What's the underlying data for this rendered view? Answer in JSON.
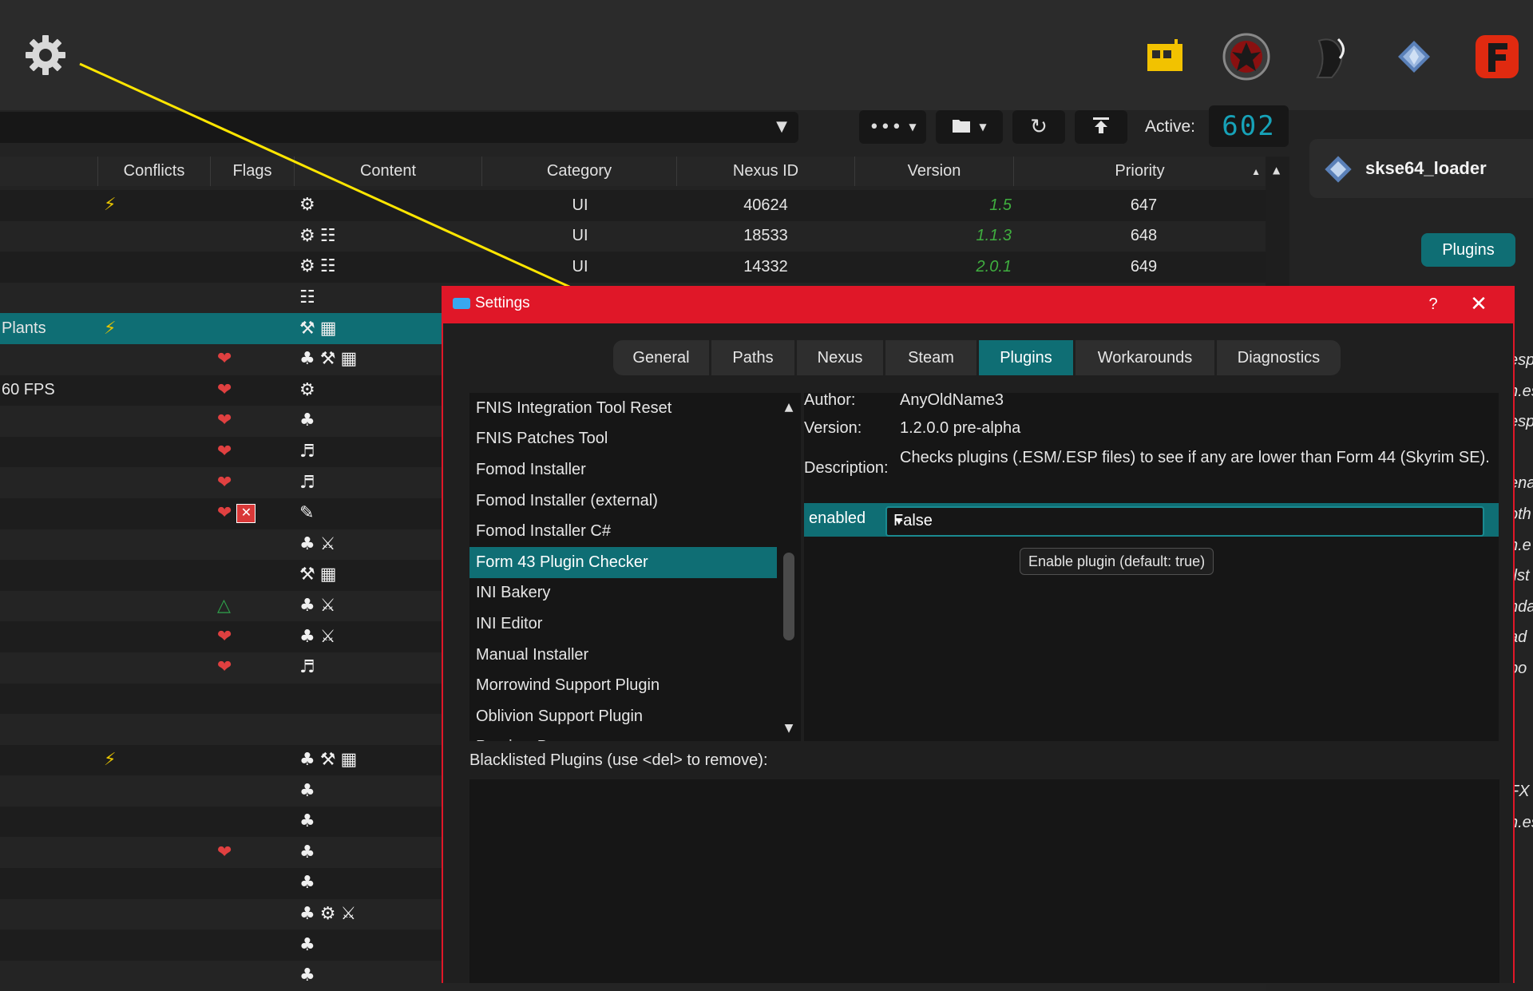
{
  "toolbar": {
    "icons": [
      "gear-icon",
      "loot-icon",
      "skyrim-dragon-icon",
      "wrye-icon",
      "skse-diamond-icon",
      "fnis-icon"
    ],
    "buttons": [
      "more-icon",
      "folder-icon",
      "refresh-icon",
      "upload-icon"
    ],
    "active_label": "Active:",
    "active_count": "602"
  },
  "executable": {
    "name": "skse64_loader"
  },
  "right_panel": {
    "tab_label": "Plugins",
    "strip_fragments": [
      "esp",
      "n.es",
      "esp",
      "",
      "ena",
      "oth",
      "n.e",
      "Ilst",
      "nda",
      "ad",
      "bo",
      "",
      "",
      "",
      "FX",
      "n.es"
    ]
  },
  "mod_table": {
    "headers": [
      "Conflicts",
      "Flags",
      "Content",
      "Category",
      "Nexus ID",
      "Version",
      "Priority"
    ],
    "rows": [
      {
        "name": "",
        "conflict": "bolt",
        "flags": [],
        "content": [
          "ui-icon"
        ],
        "category": "UI",
        "nexus_id": "40624",
        "version": "1.5",
        "priority": "647"
      },
      {
        "name": "",
        "conflict": "",
        "flags": [],
        "content": [
          "ui-icon",
          "interface-icon"
        ],
        "category": "UI",
        "nexus_id": "18533",
        "version": "1.1.3",
        "priority": "648"
      },
      {
        "name": "",
        "conflict": "",
        "flags": [],
        "content": [
          "ui-icon",
          "interface-icon"
        ],
        "category": "UI",
        "nexus_id": "14332",
        "version": "2.0.1",
        "priority": "649"
      },
      {
        "name": "",
        "conflict": "",
        "flags": [],
        "content": [
          "interface-icon"
        ],
        "category": "",
        "nexus_id": "",
        "version": "",
        "priority": ""
      },
      {
        "name": "Plants",
        "conflict": "bolt",
        "flags": [],
        "content": [
          "mesh-icon",
          "texture-icon"
        ],
        "category": "",
        "nexus_id": "",
        "version": "",
        "priority": "",
        "selected": true
      },
      {
        "name": "",
        "conflict": "",
        "flags": [
          "heart"
        ],
        "content": [
          "plugin-icon",
          "mesh-icon",
          "texture-icon"
        ],
        "category": "",
        "nexus_id": "",
        "version": "",
        "priority": ""
      },
      {
        "name": "60 FPS",
        "conflict": "",
        "flags": [
          "heart"
        ],
        "content": [
          "ui-icon"
        ],
        "category": "",
        "nexus_id": "",
        "version": "",
        "priority": ""
      },
      {
        "name": "",
        "conflict": "",
        "flags": [
          "heart"
        ],
        "content": [
          "plugin-icon"
        ],
        "category": "",
        "nexus_id": "",
        "version": "",
        "priority": ""
      },
      {
        "name": "",
        "conflict": "",
        "flags": [
          "heart"
        ],
        "content": [
          "lyre-icon"
        ],
        "category": "",
        "nexus_id": "",
        "version": "",
        "priority": ""
      },
      {
        "name": "",
        "conflict": "",
        "flags": [
          "heart"
        ],
        "content": [
          "lyre-icon"
        ],
        "category": "",
        "nexus_id": "",
        "version": "",
        "priority": ""
      },
      {
        "name": "",
        "conflict": "",
        "flags": [
          "heart",
          "x"
        ],
        "content": [
          "script-icon"
        ],
        "category": "",
        "nexus_id": "",
        "version": "",
        "priority": ""
      },
      {
        "name": "",
        "conflict": "",
        "flags": [],
        "content": [
          "plugin-icon",
          "tools-icon"
        ],
        "category": "",
        "nexus_id": "",
        "version": "",
        "priority": ""
      },
      {
        "name": "",
        "conflict": "",
        "flags": [],
        "content": [
          "mesh-icon",
          "texture-icon"
        ],
        "category": "",
        "nexus_id": "",
        "version": "",
        "priority": ""
      },
      {
        "name": "",
        "conflict": "",
        "flags": [
          "tree"
        ],
        "content": [
          "plugin-icon",
          "tools-icon"
        ],
        "category": "",
        "nexus_id": "",
        "version": "",
        "priority": ""
      },
      {
        "name": "",
        "conflict": "",
        "flags": [
          "heart"
        ],
        "content": [
          "plugin-icon",
          "tools-icon"
        ],
        "category": "",
        "nexus_id": "",
        "version": "",
        "priority": ""
      },
      {
        "name": "",
        "conflict": "",
        "flags": [
          "heart"
        ],
        "content": [
          "lyre-icon"
        ],
        "category": "",
        "nexus_id": "",
        "version": "",
        "priority": ""
      },
      {
        "name": "",
        "conflict": "",
        "flags": [],
        "content": [],
        "category": "",
        "nexus_id": "",
        "version": "",
        "priority": ""
      },
      {
        "name": "",
        "conflict": "",
        "flags": [],
        "content": [],
        "category": "",
        "nexus_id": "",
        "version": "",
        "priority": ""
      },
      {
        "name": "",
        "conflict": "bolt",
        "flags": [],
        "content": [
          "plugin-icon",
          "mesh-icon",
          "texture-icon"
        ],
        "category": "",
        "nexus_id": "",
        "version": "",
        "priority": ""
      },
      {
        "name": "",
        "conflict": "",
        "flags": [],
        "content": [
          "plugin-icon"
        ],
        "category": "",
        "nexus_id": "",
        "version": "",
        "priority": ""
      },
      {
        "name": "",
        "conflict": "",
        "flags": [],
        "content": [
          "plugin-icon"
        ],
        "category": "",
        "nexus_id": "",
        "version": "",
        "priority": ""
      },
      {
        "name": "",
        "conflict": "",
        "flags": [
          "heart"
        ],
        "content": [
          "plugin-icon"
        ],
        "category": "",
        "nexus_id": "",
        "version": "",
        "priority": ""
      },
      {
        "name": "",
        "conflict": "",
        "flags": [],
        "content": [
          "plugin-icon"
        ],
        "category": "",
        "nexus_id": "",
        "version": "",
        "priority": ""
      },
      {
        "name": "",
        "conflict": "",
        "flags": [],
        "content": [
          "plugin-icon",
          "ui-icon",
          "tools-icon"
        ],
        "category": "",
        "nexus_id": "",
        "version": "",
        "priority": ""
      },
      {
        "name": "",
        "conflict": "",
        "flags": [],
        "content": [
          "plugin-icon"
        ],
        "category": "",
        "nexus_id": "",
        "version": "",
        "priority": ""
      },
      {
        "name": "",
        "conflict": "",
        "flags": [],
        "content": [
          "plugin-icon"
        ],
        "category": "",
        "nexus_id": "",
        "version": "",
        "priority": ""
      }
    ]
  },
  "settings_dialog": {
    "title": "Settings",
    "help": "?",
    "tabs": [
      "General",
      "Paths",
      "Nexus",
      "Steam",
      "Plugins",
      "Workarounds",
      "Diagnostics"
    ],
    "active_tab": "Plugins",
    "plugin_list": [
      "FNIS Integration Tool Reset",
      "FNIS Patches Tool",
      "Fomod Installer",
      "Fomod Installer (external)",
      "Fomod Installer C#",
      "Form 43 Plugin Checker",
      "INI Bakery",
      "INI Editor",
      "Manual Installer",
      "Morrowind Support Plugin",
      "Oblivion Support Plugin",
      "Preview B..."
    ],
    "selected_plugin": "Form 43 Plugin Checker",
    "details": {
      "author_label": "Author:",
      "author": "AnyOldName3",
      "version_label": "Version:",
      "version": "1.2.0.0 pre-alpha",
      "description_label": "Description:",
      "description": "Checks plugins (.ESM/.ESP files) to see if any are lower than Form 44 (Skyrim SE)."
    },
    "setting": {
      "name": "enabled",
      "value": "False",
      "tooltip": "Enable plugin (default: true)"
    },
    "blacklist_label": "Blacklisted Plugins (use <del> to remove):"
  },
  "colors": {
    "accent": "#0f6e74",
    "dialog_title": "#e01728",
    "version_green": "#3fae3f",
    "counter": "#17a2b8",
    "annotation_line": "#ffe600"
  }
}
